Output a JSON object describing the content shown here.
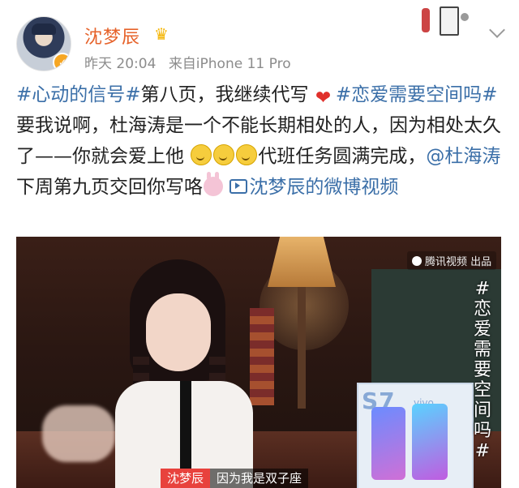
{
  "post": {
    "username": "沈梦辰",
    "crown_icon": "crown-icon",
    "time": "昨天 20:04",
    "source": "来自iPhone 11 Pro",
    "body": {
      "hashtag1": "#心动的信号#",
      "t1": "第八页，我继续代写",
      "heart_icon": "heart-icon",
      "hashtag2": "#恋爱需要空间吗#",
      "t2": "要我说啊，杜海涛是一个不能长期相处的人，因为相处太久了——你就会爱上他",
      "smile_icon": "smile-icon",
      "t3": "代班任务圆满完成，",
      "mention": "@杜海涛",
      "t4": " 下周第九页交回你写咯",
      "bunny_icon": "bunny-icon",
      "video_link": "沈梦辰的微博视频",
      "video_link_icon": "video-icon"
    },
    "video": {
      "watermark": "腾讯视频 出品",
      "vertical_tag": "#恋爱需要空间吗#",
      "product_text": "S7",
      "brand_text": "vivo",
      "caption_name": "沈梦辰",
      "caption_text": "因为我是双子座"
    }
  },
  "colors": {
    "username": "#e6632b",
    "link": "#3b6fa8",
    "meta": "#8c8c8c",
    "heart": "#e0302b"
  }
}
